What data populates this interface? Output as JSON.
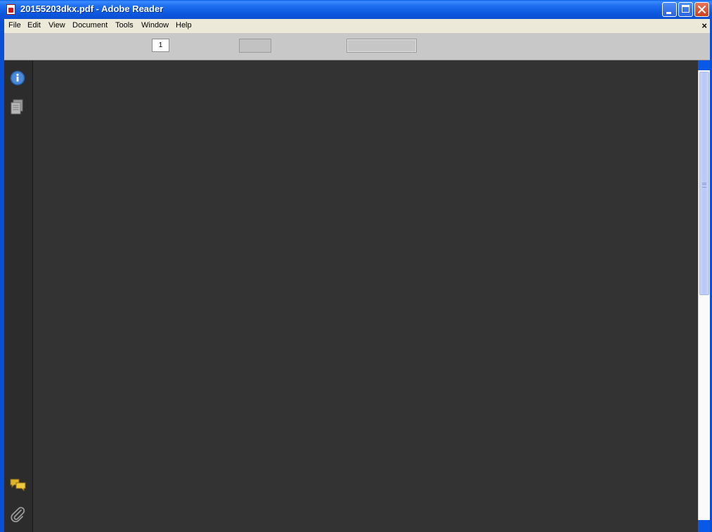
{
  "window": {
    "title": "20155203dkx.pdf - Adobe Reader"
  },
  "menubar": {
    "items": [
      "File",
      "Edit",
      "View",
      "Document",
      "Tools",
      "Window",
      "Help"
    ],
    "doc_close_label": "×"
  },
  "toolbar": {
    "page_number": "1",
    "zoom_value": "",
    "find_placeholder": ""
  },
  "navpane": {
    "icons": [
      "info-icon",
      "pages-icon",
      "comments-icon",
      "attachments-icon"
    ]
  },
  "colors": {
    "titlebar": "#0a58e6",
    "document_background": "#333333",
    "navpane_background": "#2c2c2c",
    "toolbar_background": "#c8c8c8"
  }
}
